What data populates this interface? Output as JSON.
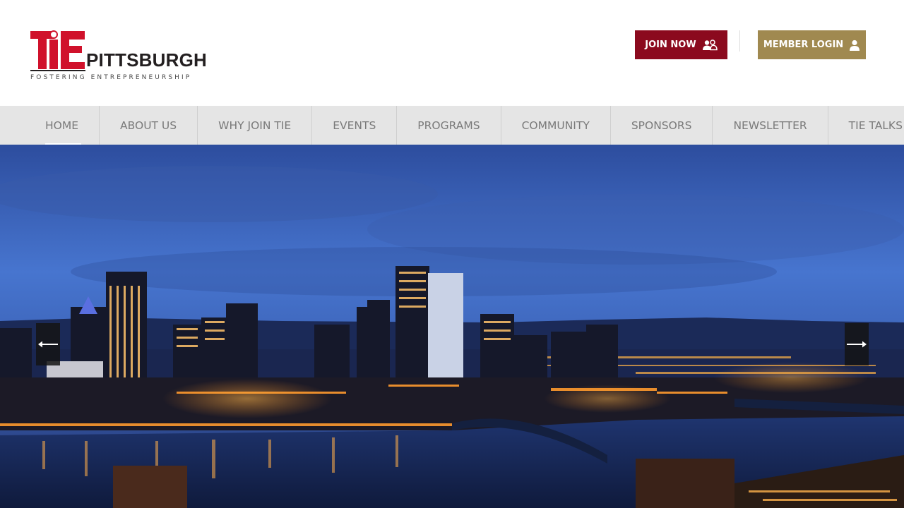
{
  "brand": {
    "logo_mark": "TiE",
    "logo_word": "PITTSBURGH",
    "tagline": "FOSTERING ENTREPRENEURSHIP"
  },
  "header": {
    "join_label": "JOIN NOW",
    "join_icon": "users-icon",
    "login_label": "MEMBER LOGIN",
    "login_icon": "user-icon"
  },
  "nav": {
    "items": [
      {
        "label": "HOME",
        "active": true
      },
      {
        "label": "ABOUT US"
      },
      {
        "label": "WHY JOIN TIE"
      },
      {
        "label": "EVENTS"
      },
      {
        "label": "PROGRAMS"
      },
      {
        "label": "COMMUNITY"
      },
      {
        "label": "SPONSORS"
      },
      {
        "label": "NEWSLETTER"
      },
      {
        "label": "TIE TALKS"
      }
    ]
  },
  "hero": {
    "prev_icon": "arrow-left-icon",
    "next_icon": "arrow-right-icon"
  },
  "colors": {
    "join_bg": "#8b0a1e",
    "login_bg": "#a08950",
    "nav_bg": "#e5e5e5",
    "nav_text": "#7a7a7a",
    "brand_red": "#c8102e"
  }
}
